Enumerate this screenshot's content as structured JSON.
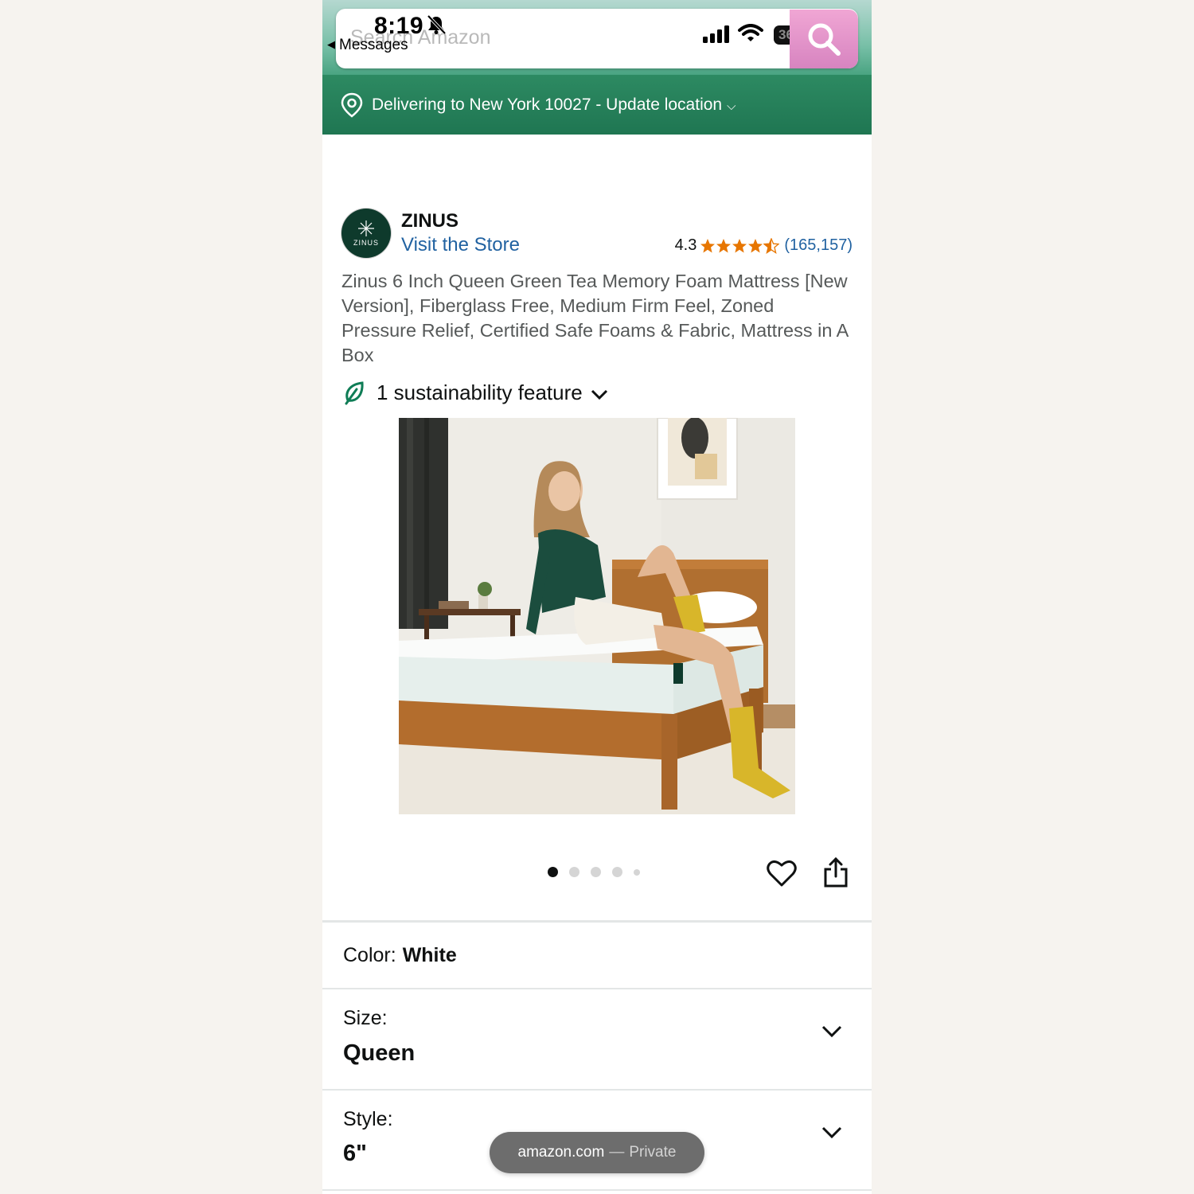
{
  "status_bar": {
    "time": "8:19",
    "back_label": "Messages",
    "battery": "36"
  },
  "search": {
    "placeholder": "Search Amazon"
  },
  "delivery": {
    "text": "Delivering to New York 10027 - Update location"
  },
  "brand": {
    "logo_text": "ZINUS",
    "name": "ZINUS",
    "store_link": "Visit the Store"
  },
  "rating": {
    "value": "4.3",
    "stars": 4.3,
    "count": "(165,157)"
  },
  "product": {
    "title": "Zinus 6 Inch Queen Green Tea Memory Foam Mattress [New Version], Fiberglass Free, Medium Firm Feel, Zoned Pressure Relief, Certified Safe Foams & Fabric, Mattress in A Box",
    "image_alt": "Woman sitting on a white mattress on a wooden bed frame",
    "image_count": 5,
    "active_image": 1
  },
  "sustainability": {
    "label": "1 sustainability feature"
  },
  "options": {
    "color": {
      "label": "Color:",
      "value": "White"
    },
    "size": {
      "label": "Size:",
      "value": "Queen"
    },
    "style": {
      "label": "Style:",
      "value": "6\""
    }
  },
  "url_pill": {
    "domain": "amazon.com",
    "separator": "—",
    "mode": "Private"
  },
  "colors": {
    "header_green": "#237c5a",
    "link_blue": "#2162a1",
    "star_orange": "#e77600",
    "brand_dark": "#0e3a2c"
  }
}
